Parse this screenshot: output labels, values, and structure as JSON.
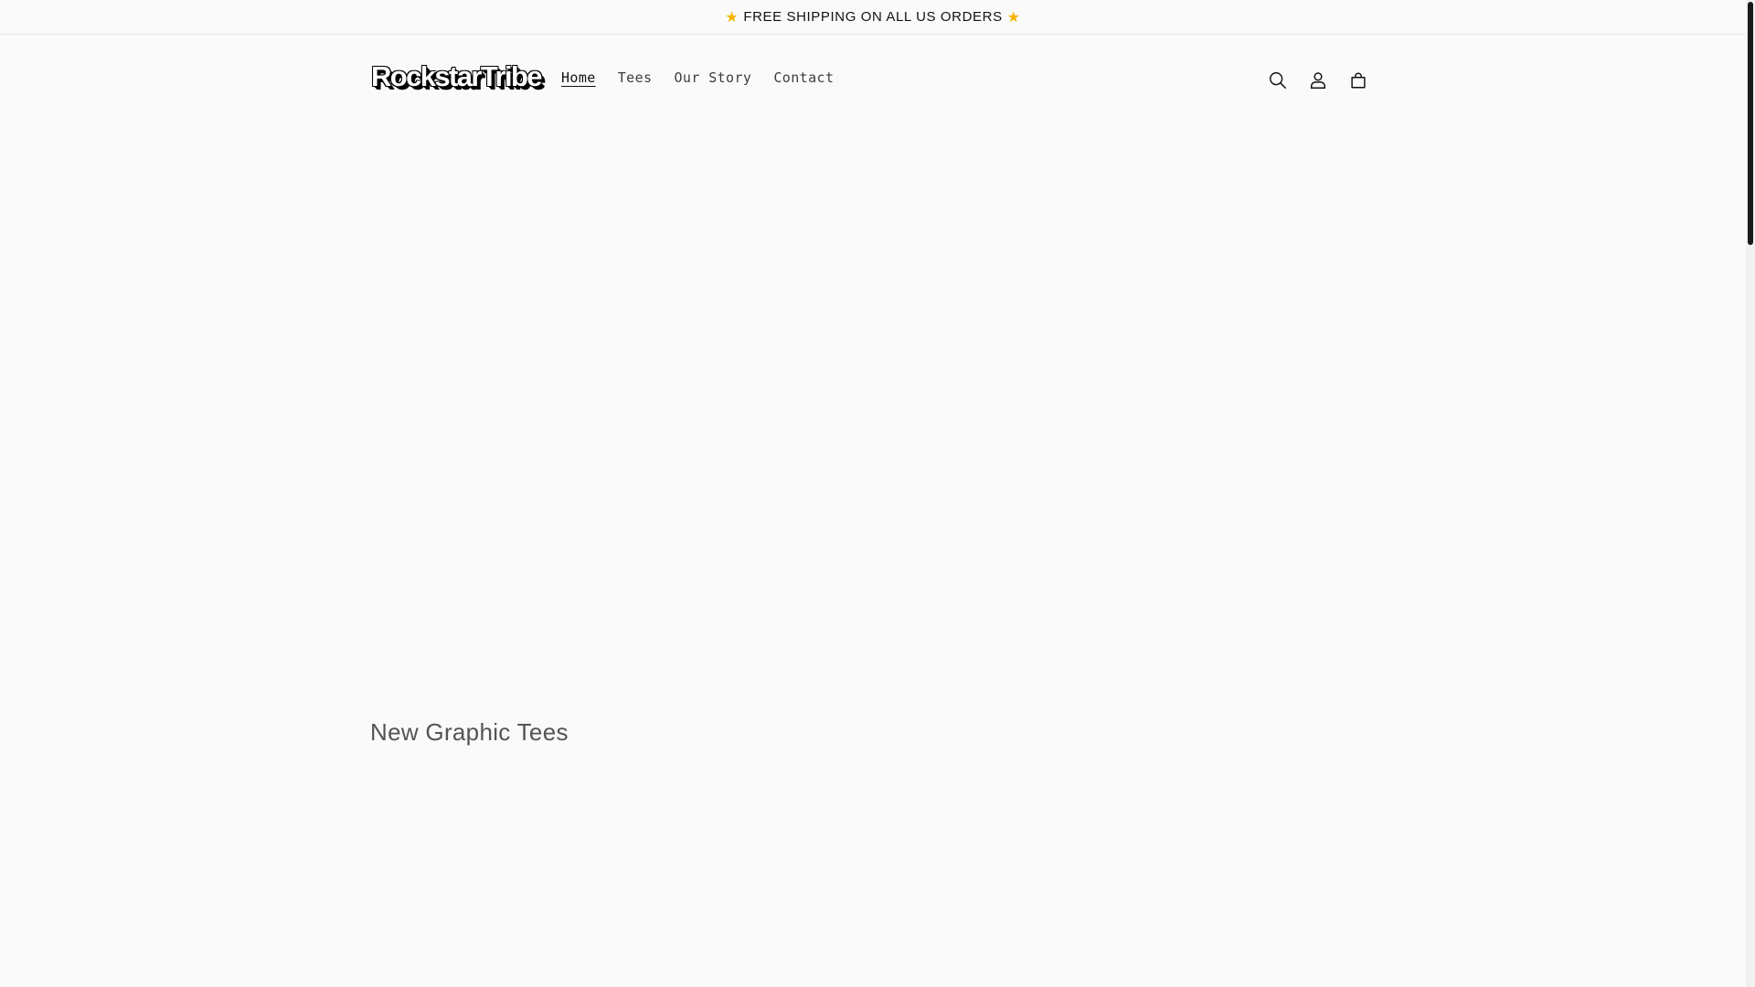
{
  "announcement": {
    "text": "FREE SHIPPING ON ALL US ORDERS",
    "star_icon": "star-icon",
    "star_color": "#f5b400"
  },
  "header": {
    "logo_text": "RockstarTribe",
    "nav": [
      {
        "label": "Home",
        "active": true
      },
      {
        "label": "Tees",
        "active": false
      },
      {
        "label": "Our Story",
        "active": false
      },
      {
        "label": "Contact",
        "active": false
      }
    ],
    "icons": [
      "search-icon",
      "account-icon",
      "cart-icon"
    ]
  },
  "main": {
    "section_title": "New Graphic Tees"
  }
}
